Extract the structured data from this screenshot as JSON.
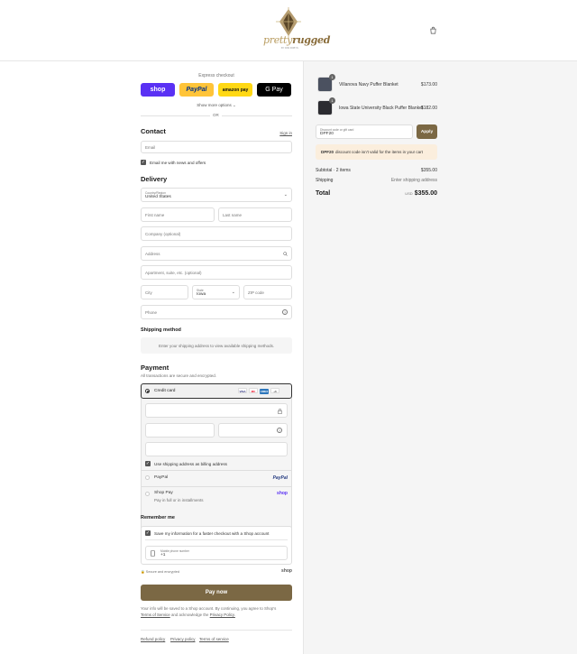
{
  "brand": {
    "logo_text_a": "pretty",
    "logo_text_b": "rugged",
    "tagline": "BY PAM ROBYN"
  },
  "express": {
    "title": "Express checkout",
    "buttons": [
      "shop",
      "PayPal",
      "amazon pay",
      "G Pay"
    ],
    "more_label": "Show more options",
    "or_label": "OR"
  },
  "contact": {
    "title": "Contact",
    "sign_in": "Sign in",
    "email_placeholder": "Email",
    "news_label": "Email me with news and offers",
    "news_checked": true
  },
  "delivery": {
    "title": "Delivery",
    "country_label": "Country/Region",
    "country_value": "United States",
    "first_name": "First name",
    "last_name": "Last name",
    "company": "Company (optional)",
    "address": "Address",
    "apartment": "Apartment, suite, etc. (optional)",
    "city": "City",
    "state_label": "State",
    "state_value": "Iowa",
    "zip": "ZIP code",
    "phone": "Phone"
  },
  "shipping": {
    "title": "Shipping method",
    "message": "Enter your shipping address to view available shipping methods."
  },
  "payment": {
    "title": "Payment",
    "subtitle": "All transactions are secure and encrypted.",
    "credit_card_label": "Credit card",
    "card_brands": [
      "VISA",
      "MC",
      "AMEX",
      "+6"
    ],
    "billing_label": "Use shipping address as billing address",
    "paypal_label": "PayPal",
    "paypal_logo": "PayPal",
    "shoppay_label": "Shop Pay",
    "shoppay_sub": "Pay in full or in installments",
    "shoppay_logo": "shop"
  },
  "remember": {
    "title": "Remember me",
    "save_label": "Save my information for a faster checkout with a Shop account",
    "phone_label": "Mobile phone number",
    "phone_value": "+1",
    "secure_label": "Secure and encrypted",
    "shop_logo": "shop"
  },
  "pay_button": "Pay now",
  "legal": {
    "line1": "Your info will be saved to a Shop account. By continuing, you agree to Shop's",
    "tos": "Terms of Service",
    "and_ack": "and acknowledge the",
    "privacy": "Privacy Policy."
  },
  "footer": [
    "Refund policy",
    "Privacy policy",
    "Terms of service"
  ],
  "order": {
    "items": [
      {
        "name": "Villanova Navy Puffer Blanket",
        "price": "$173.00",
        "qty": "1"
      },
      {
        "name": "Iowa State University Black Puffer Blanket",
        "price": "$182.00",
        "qty": "1"
      }
    ],
    "discount_label": "Discount code or gift card",
    "discount_value": "DPF20",
    "apply_label": "Apply",
    "discount_error_code": "DPF20",
    "discount_error_msg": "discount code isn't valid for the items in your cart",
    "subtotal_label": "Subtotal · 2 items",
    "subtotal_value": "$355.00",
    "shipping_label": "Shipping",
    "shipping_value": "Enter shipping address",
    "total_label": "Total",
    "currency": "USD",
    "total_value": "$355.00"
  }
}
